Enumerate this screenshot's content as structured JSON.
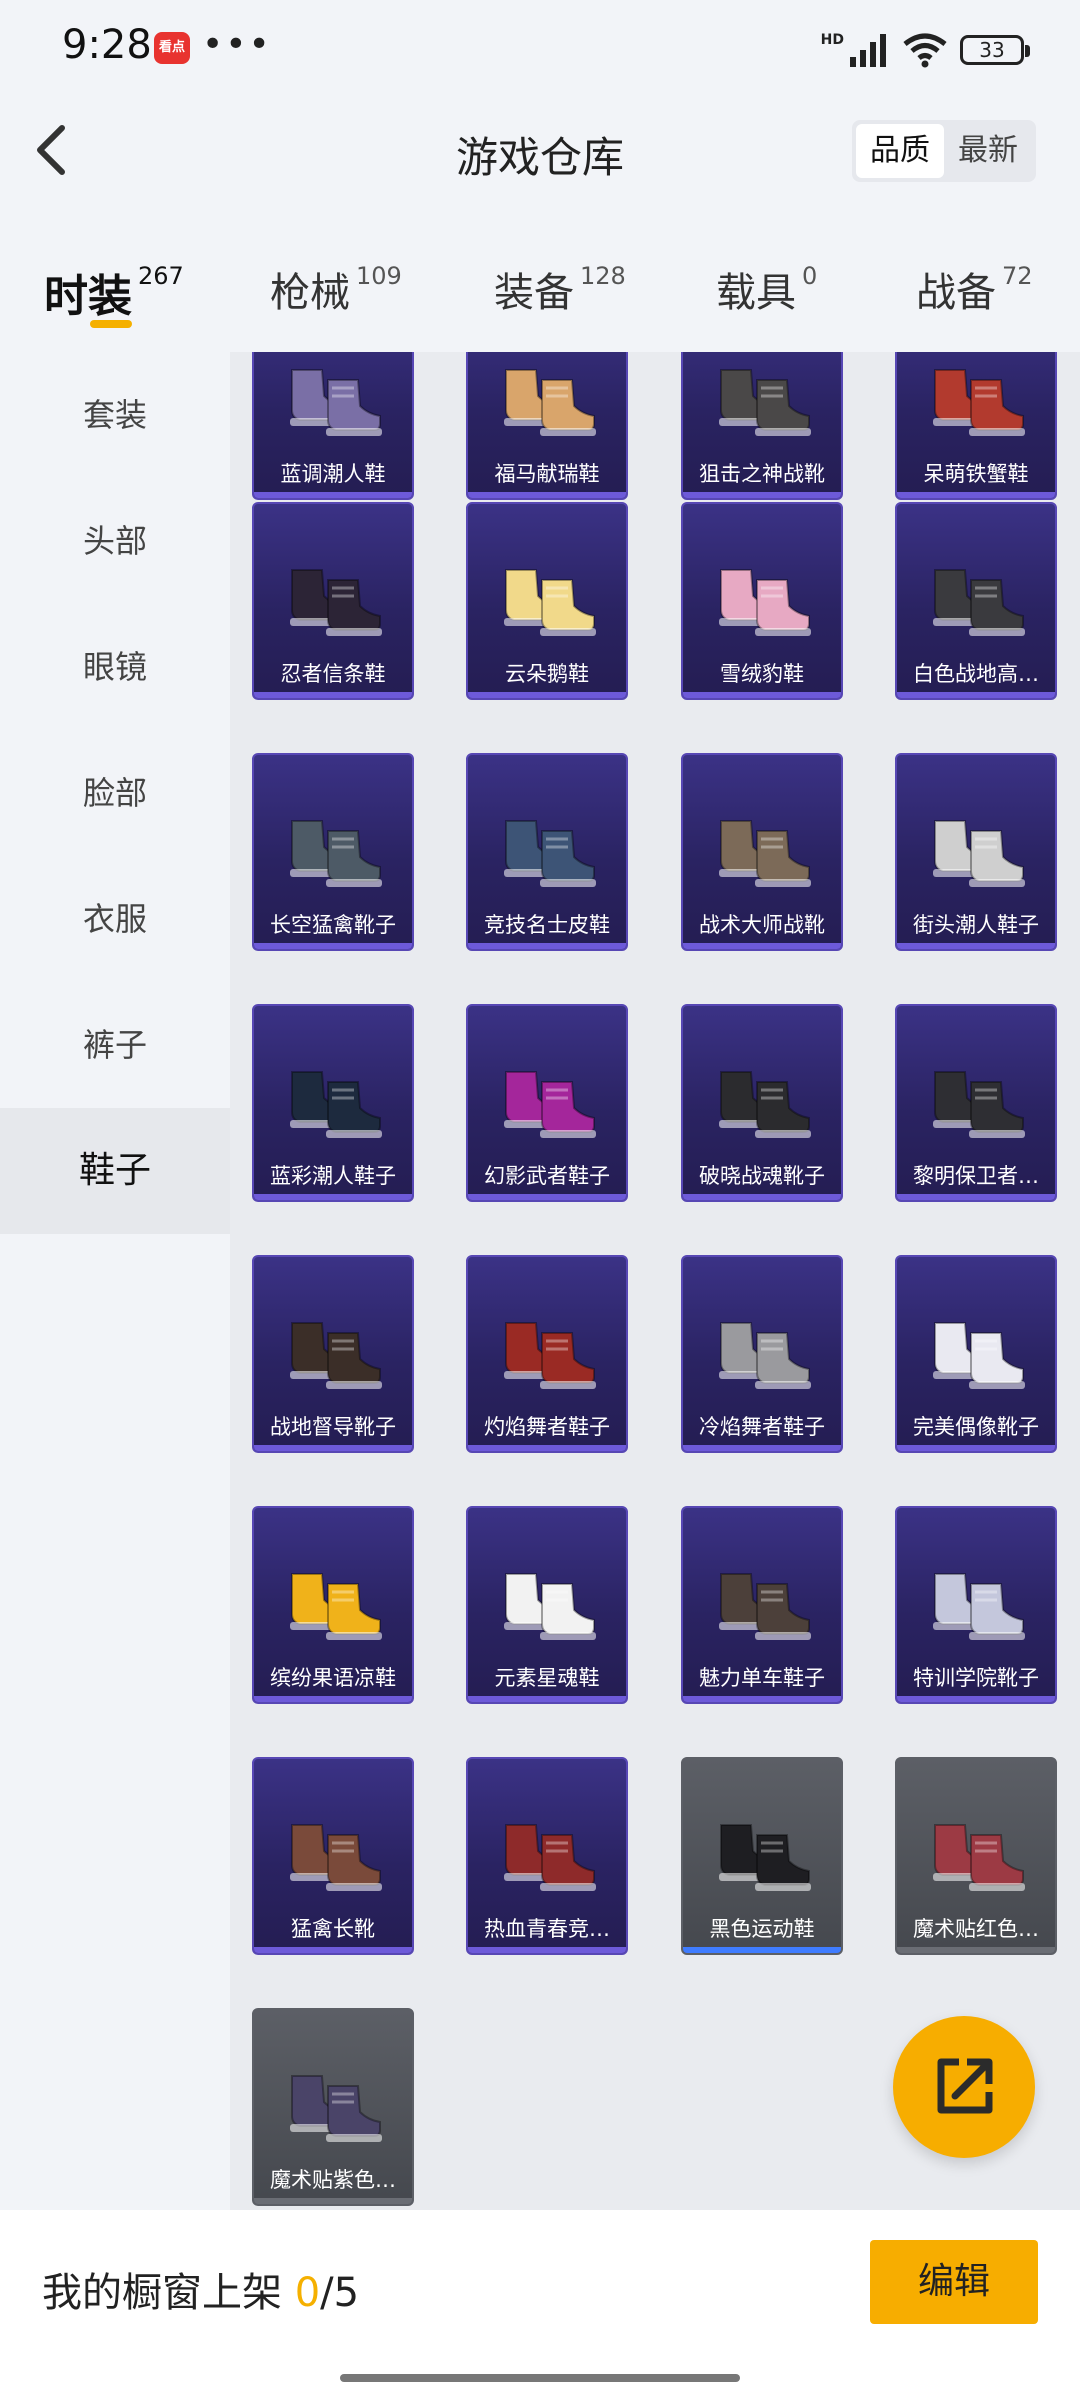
{
  "status_bar": {
    "time": "9:28",
    "app_badge": "看点",
    "more": "•••",
    "network": "HD",
    "battery": "33"
  },
  "header": {
    "title": "游戏仓库",
    "sort_options": [
      "品质",
      "最新"
    ],
    "sort_active": "品质"
  },
  "tabs": [
    {
      "label": "时装",
      "count": "267",
      "active": true
    },
    {
      "label": "枪械",
      "count": "109"
    },
    {
      "label": "装备",
      "count": "128"
    },
    {
      "label": "载具",
      "count": "0"
    },
    {
      "label": "战备",
      "count": "72"
    }
  ],
  "sidebar": [
    {
      "label": "套装"
    },
    {
      "label": "头部"
    },
    {
      "label": "眼镜"
    },
    {
      "label": "脸部"
    },
    {
      "label": "衣服"
    },
    {
      "label": "裤子"
    },
    {
      "label": "鞋子",
      "active": true
    }
  ],
  "items": [
    {
      "name": "蓝调潮人鞋",
      "style": "purple",
      "shoe": "#7a6fa6"
    },
    {
      "name": "福马献瑞鞋",
      "style": "purple",
      "shoe": "#d9a56b"
    },
    {
      "name": "狙击之神战靴",
      "style": "purple",
      "shoe": "#4a4848"
    },
    {
      "name": "呆萌铁蟹鞋",
      "style": "purple",
      "shoe": "#b23a2e"
    },
    {
      "name": "忍者信条鞋",
      "style": "purple",
      "shoe": "#2c2436"
    },
    {
      "name": "云朵鹅鞋",
      "style": "purple",
      "shoe": "#f1d98a"
    },
    {
      "name": "雪绒豹鞋",
      "style": "purple",
      "shoe": "#e7a9c3"
    },
    {
      "name": "白色战地高…",
      "style": "purple",
      "shoe": "#3a3a3e"
    },
    {
      "name": "长空猛禽靴子",
      "style": "purple",
      "shoe": "#4d5a66"
    },
    {
      "name": "竞技名士皮鞋",
      "style": "purple",
      "shoe": "#3d5476"
    },
    {
      "name": "战术大师战靴",
      "style": "purple",
      "shoe": "#7c6a58"
    },
    {
      "name": "街头潮人鞋子",
      "style": "purple",
      "shoe": "#cfcfcf"
    },
    {
      "name": "蓝彩潮人鞋子",
      "style": "purple",
      "shoe": "#1d2a3e"
    },
    {
      "name": "幻影武者鞋子",
      "style": "purple",
      "shoe": "#a4269b"
    },
    {
      "name": "破晓战魂靴子",
      "style": "purple",
      "shoe": "#2b2b2e"
    },
    {
      "name": "黎明保卫者…",
      "style": "purple",
      "shoe": "#2e2e33"
    },
    {
      "name": "战地督导靴子",
      "style": "purple",
      "shoe": "#3b2e28"
    },
    {
      "name": "灼焰舞者鞋子",
      "style": "purple",
      "shoe": "#9a2a24"
    },
    {
      "name": "冷焰舞者鞋子",
      "style": "purple",
      "shoe": "#9a9a9e"
    },
    {
      "name": "完美偶像靴子",
      "style": "purple",
      "shoe": "#e9e9f1"
    },
    {
      "name": "缤纷果语凉鞋",
      "style": "purple",
      "shoe": "#f0b21a"
    },
    {
      "name": "元素星魂鞋",
      "style": "purple",
      "shoe": "#f2f2f2"
    },
    {
      "name": "魅力单车鞋子",
      "style": "purple",
      "shoe": "#4c403a"
    },
    {
      "name": "特训学院靴子",
      "style": "purple",
      "shoe": "#c4c7dc"
    },
    {
      "name": "猛禽长靴",
      "style": "purple",
      "shoe": "#7a4a3a"
    },
    {
      "name": "热血青春竞…",
      "style": "purple",
      "shoe": "#8e2a2a"
    },
    {
      "name": "黑色运动鞋",
      "style": "gray",
      "selected": true,
      "shoe": "#1e1e22"
    },
    {
      "name": "魔术贴红色…",
      "style": "gray",
      "shoe": "#9c3a44"
    },
    {
      "name": "魔术贴紫色…",
      "style": "gray",
      "shoe": "#4a4468"
    }
  ],
  "bottom_bar": {
    "label": "我的橱窗上架",
    "count": "0",
    "total": "/5",
    "edit_button": "编辑"
  },
  "colors": {
    "accent": "#f7ad00",
    "card_purple": "#2a2362",
    "card_gray": "#4a4d54",
    "selected_bar": "#3f7cff"
  }
}
